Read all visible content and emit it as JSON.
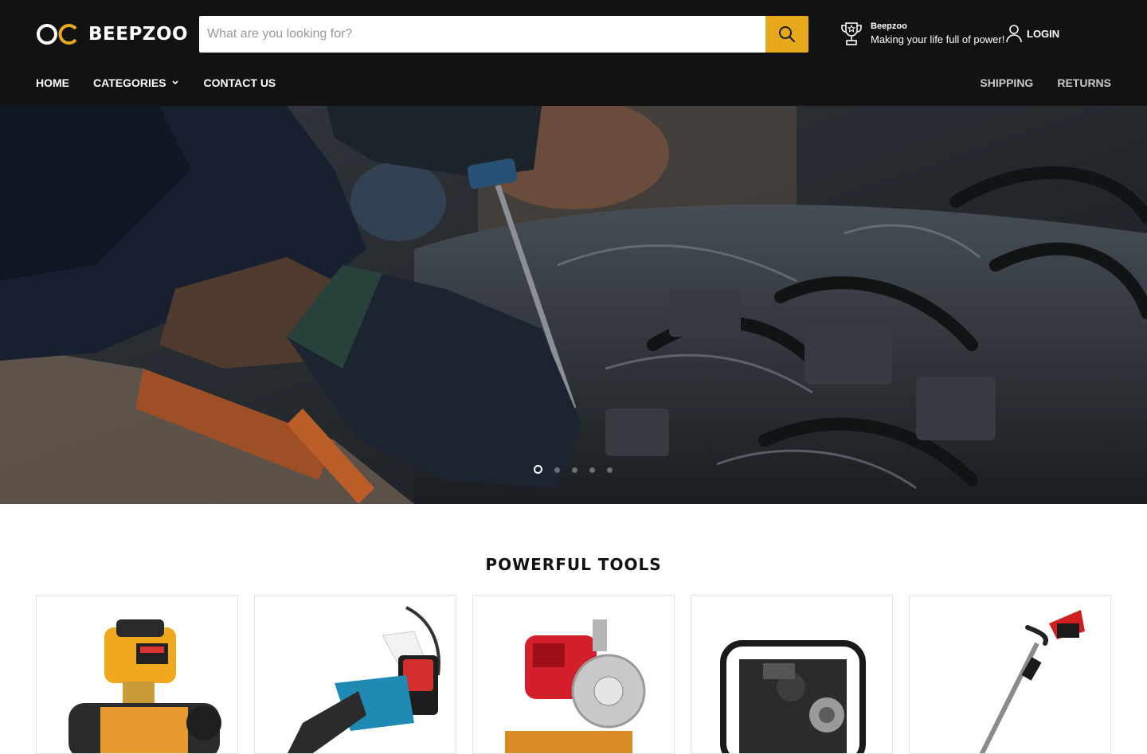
{
  "brand": {
    "logo_text": "BEEPZOO"
  },
  "search": {
    "placeholder": "What are you looking for?"
  },
  "promo": {
    "title": "Beepzoo",
    "subtitle": "Making your life full of power!"
  },
  "account": {
    "login_label": "LOGIN"
  },
  "nav": {
    "left": [
      "HOME",
      "CATEGORIES",
      "CONTACT US"
    ],
    "right": [
      "SHIPPING",
      "RETURNS"
    ]
  },
  "hero": {
    "slide_count": 5,
    "active_slide": 1
  },
  "section": {
    "title": "POWERFUL TOOLS"
  },
  "colors": {
    "header_bg": "#121212",
    "accent": "#e8a81c",
    "text_on_dark": "#ffffff"
  },
  "icons": {
    "search": "search-icon",
    "promo": "trophy-icon",
    "login": "user-icon",
    "categories_dropdown": "chevron-down-icon"
  }
}
